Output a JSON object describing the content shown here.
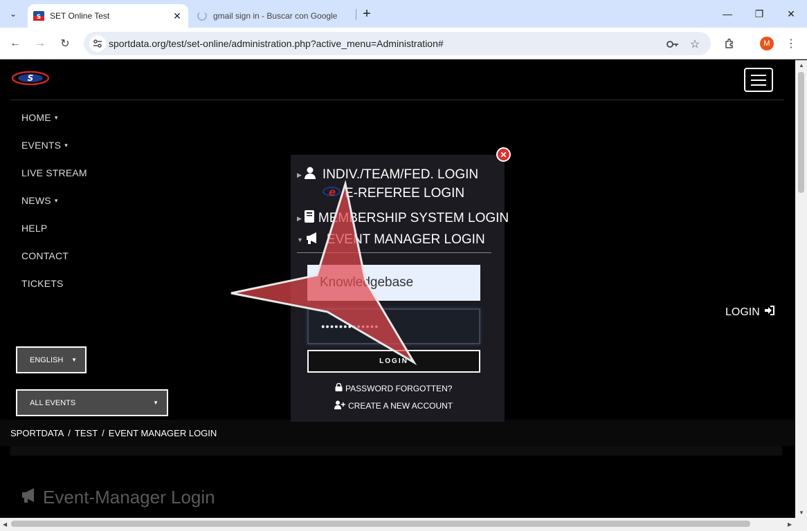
{
  "browser": {
    "tabs": [
      {
        "title": "SET Online Test",
        "active": true
      },
      {
        "title": "gmail sign in - Buscar con Google",
        "active": false
      }
    ],
    "url": "sportdata.org/test/set-online/administration.php?active_menu=Administration#",
    "profile_initial": "M"
  },
  "nav": {
    "menu": [
      {
        "label": "HOME",
        "caret": "▾"
      },
      {
        "label": "EVENTS",
        "caret": "▾"
      },
      {
        "label": "LIVE STREAM",
        "caret": ""
      },
      {
        "label": "NEWS",
        "caret": "▾"
      },
      {
        "label": "HELP",
        "caret": ""
      },
      {
        "label": "CONTACT",
        "caret": ""
      },
      {
        "label": "TICKETS",
        "caret": ""
      }
    ],
    "login_label": "LOGIN",
    "language": "ENGLISH",
    "events_filter": "ALL EVENTS"
  },
  "breadcrumb": [
    "SPORTDATA",
    "TEST",
    "EVENT MANAGER LOGIN"
  ],
  "subtitle": "EVENT MANAGER LOGIN",
  "section_title": "Event-Manager Login",
  "modal": {
    "options": {
      "indiv": "INDIV./TEAM/FED. LOGIN",
      "ereferee": "E-REFEREE LOGIN",
      "membership": "MEMBERSHIP SYSTEM LOGIN",
      "eventmanager": "EVENT MANAGER LOGIN"
    },
    "username_value": "Knowledgebase",
    "password_mask": "●●●●●●●●●●●●●",
    "login_button": "LOGIN",
    "forgot_link": "PASSWORD FORGOTTEN?",
    "create_link": "CREATE A NEW ACCOUNT"
  },
  "colors": {
    "star_overlay": "#e0474c",
    "close_button": "#d9322e",
    "profile_avatar": "#e8541c"
  }
}
